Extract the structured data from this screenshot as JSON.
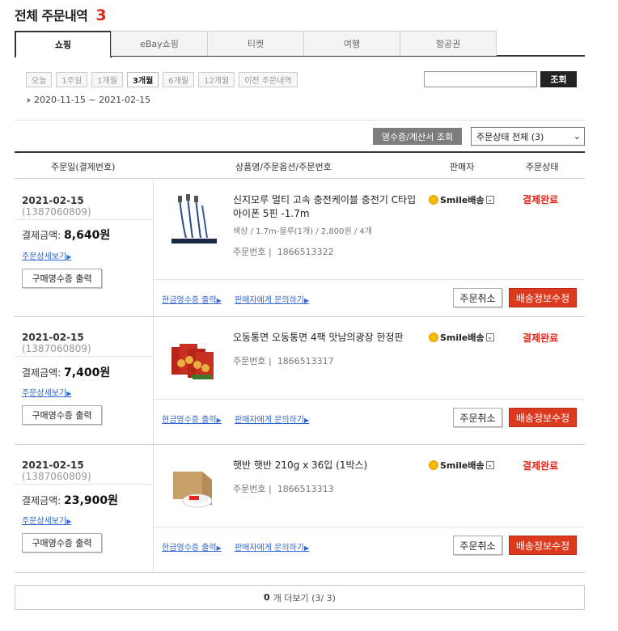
{
  "header": {
    "title": "전체 주문내역",
    "count": "3"
  },
  "tabs": [
    {
      "label": "쇼핑",
      "active": true
    },
    {
      "label": "eBay쇼핑"
    },
    {
      "label": "티켓"
    },
    {
      "label": "여행"
    },
    {
      "label": "항공권"
    }
  ],
  "periods": [
    "오늘",
    "1주일",
    "1개월",
    "3개월",
    "6개월",
    "12개월",
    "이전 주문내역"
  ],
  "active_period": "3개월",
  "search": {
    "value": "",
    "button": "조회"
  },
  "date_range": "2020-11-15 ~ 2021-02-15",
  "receipt_button": "영수증/계산서 조회",
  "status_filter": "주문상태 전체 (3)",
  "columns": {
    "date": "주문일(결제번호)",
    "product": "상품명/주문옵션/주문번호",
    "seller": "판매자",
    "status": "주문상태"
  },
  "labels": {
    "amount_prefix": "결제금액:",
    "currency": "원",
    "order_detail": "주문상세보기",
    "purchase_receipt": "구매영수증 출력",
    "order_no_label": "주문번호 |",
    "cash_receipt": "현금영수증 출력",
    "contact_seller": "판매자에게 문의하기",
    "cancel": "주문취소",
    "ship_edit": "배송정보수정",
    "seller_smile": "Smile배송"
  },
  "orders": [
    {
      "date": "2021-02-15",
      "payment_no": "(1387060809)",
      "amount": "8,640",
      "product_name": "신지모루 멀티 고속 충전케이블 충전기 C타입 아이폰 5핀 -1.7m",
      "option": "색상 / 1.7m-블루(1개) / 2,800원 / 4개",
      "order_no": "1866513322",
      "status": "결제완료",
      "thumb": "cable-icon"
    },
    {
      "date": "2021-02-15",
      "payment_no": "(1387060809)",
      "amount": "7,400",
      "product_name": "오동통면 오동통면 4팩 맛남의광장 한정판",
      "option": "",
      "order_no": "1866513317",
      "status": "결제완료",
      "thumb": "noodle-pack-icon"
    },
    {
      "date": "2021-02-15",
      "payment_no": "(1387060809)",
      "amount": "23,900",
      "product_name": "햇반 햇반 210g x 36입 (1박스)",
      "option": "",
      "order_no": "1866513313",
      "status": "결제완료",
      "thumb": "rice-box-icon"
    }
  ],
  "more": {
    "count": "0",
    "text": "개 더보기 (3/ 3)"
  },
  "colors": {
    "accent_red": "#e0281a",
    "ship_button": "#dc3a1f",
    "link_blue": "#3366cc"
  }
}
